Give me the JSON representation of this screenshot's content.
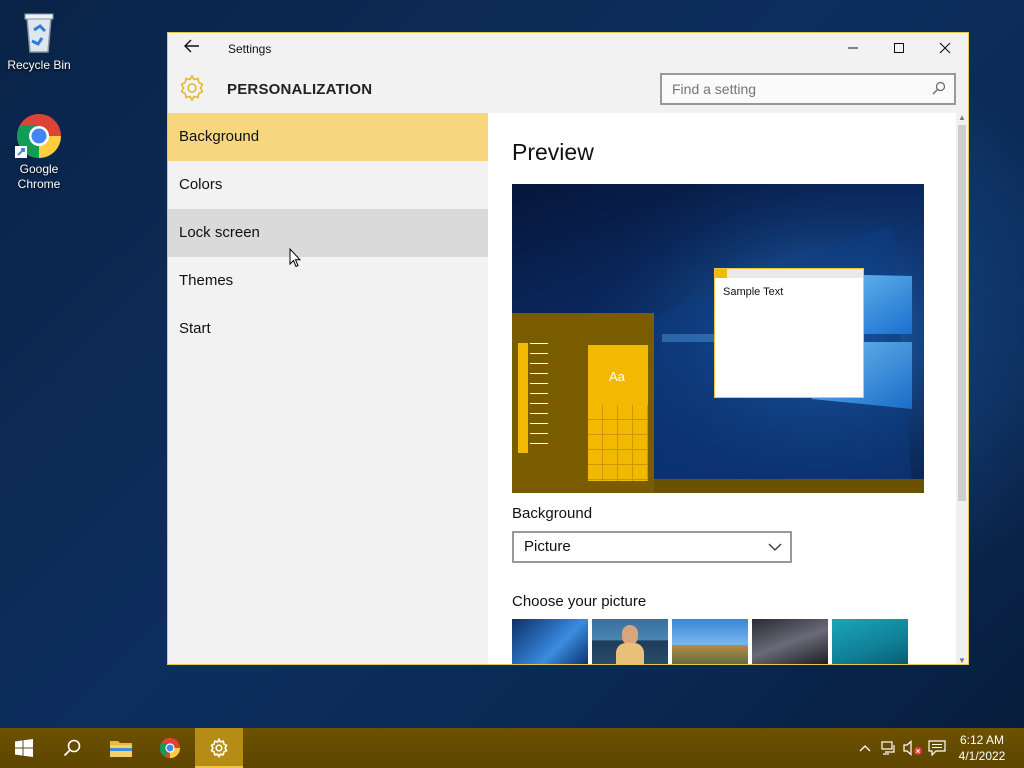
{
  "desktop": {
    "icons": [
      {
        "label": "Recycle Bin"
      },
      {
        "label": "Google Chrome"
      }
    ]
  },
  "window": {
    "title": "Settings",
    "page_title": "PERSONALIZATION",
    "search_placeholder": "Find a setting",
    "nav": [
      {
        "label": "Background",
        "state": "selected"
      },
      {
        "label": "Colors",
        "state": "normal"
      },
      {
        "label": "Lock screen",
        "state": "hover"
      },
      {
        "label": "Themes",
        "state": "normal"
      },
      {
        "label": "Start",
        "state": "normal"
      }
    ],
    "content": {
      "heading": "Preview",
      "preview_sample_text": "Sample Text",
      "preview_tile_text": "Aa",
      "background_label": "Background",
      "background_value": "Picture",
      "choose_label": "Choose your picture"
    }
  },
  "taskbar": {
    "time": "6:12 AM",
    "date": "4/1/2022"
  },
  "colors": {
    "accent": "#f3c53a",
    "selected_nav": "#f6d780",
    "taskbar": "#6e5200"
  }
}
